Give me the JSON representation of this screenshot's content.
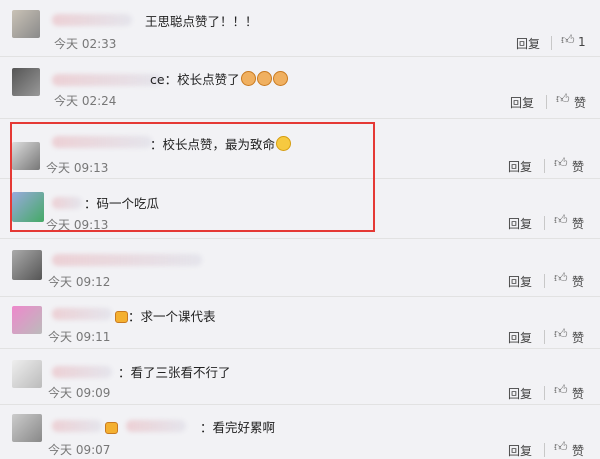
{
  "comments": [
    {
      "text": "王思聪点赞了！！！",
      "time": "今天 02:33",
      "reply": "回复",
      "like": "1",
      "thumb_icon": "thumbs-up-icon"
    },
    {
      "text": "ce：校长点赞了",
      "time": "今天 02:24",
      "reply": "回复",
      "like": "赞",
      "thumb_icon": "thumbs-up-icon",
      "emojis": [
        "cat-emoji",
        "cat-emoji",
        "cat-emoji"
      ]
    },
    {
      "text": "：校长点赞，最为致命",
      "time": "今天 09:13",
      "reply": "回复",
      "like": "赞",
      "thumb_icon": "thumbs-up-icon",
      "emojis": [
        "shy-emoji"
      ]
    },
    {
      "text": "：码一个吃瓜",
      "time": "今天 09:13",
      "reply": "回复",
      "like": "赞",
      "thumb_icon": "thumbs-up-icon"
    },
    {
      "text": "",
      "time": "今天 09:12",
      "reply": "回复",
      "like": "赞",
      "thumb_icon": "thumbs-up-icon"
    },
    {
      "text": "：求一个课代表",
      "time": "今天 09:11",
      "reply": "回复",
      "like": "赞",
      "thumb_icon": "thumbs-up-icon",
      "emojis": [
        "crown-emoji"
      ]
    },
    {
      "text": "：看了三张看不行了",
      "time": "今天 09:09",
      "reply": "回复",
      "like": "赞",
      "thumb_icon": "thumbs-up-icon"
    },
    {
      "text": "：看完好累啊",
      "time": "今天 09:07",
      "reply": "回复",
      "like": "赞",
      "thumb_icon": "thumbs-up-icon",
      "emojis": [
        "crown-emoji"
      ]
    }
  ],
  "colors": {
    "highlight": "#e53935",
    "background": "#f2f2f5"
  }
}
